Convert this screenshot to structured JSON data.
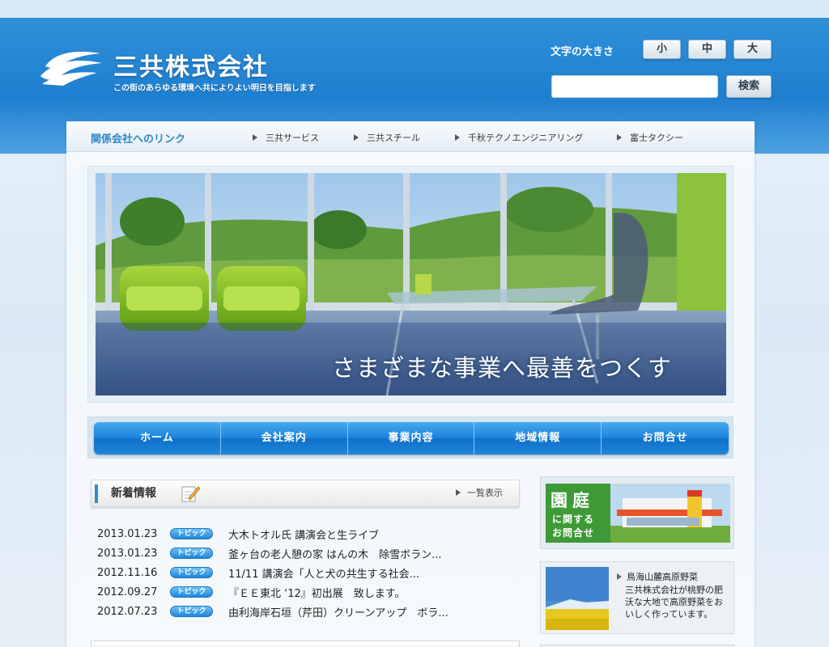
{
  "header": {
    "company_name": "三共株式会社",
    "tagline": "この街のあらゆる環境へ共によりよい明日を目指します",
    "font_size_label": "文字の大きさ",
    "font_sizes": [
      "小",
      "中",
      "大"
    ],
    "search_placeholder": "",
    "search_button": "検索"
  },
  "related_links": {
    "title": "関係会社へのリンク",
    "items": [
      "三共サービス",
      "三共スチール",
      "千秋テクノエンジニアリング",
      "富士タクシー"
    ]
  },
  "hero": {
    "caption": "さまざまな事業へ最善をつくす"
  },
  "nav": {
    "items": [
      "ホーム",
      "会社案内",
      "事業内容",
      "地域情報",
      "お問合せ"
    ]
  },
  "news": {
    "title": "新着情報",
    "more_label": "一覧表示",
    "items": [
      {
        "date": "2013.01.23",
        "tag": "トピック",
        "text": "大木トオル氏 講演会と生ライブ"
      },
      {
        "date": "2013.01.23",
        "tag": "トピック",
        "text": "釜ヶ台の老人憩の家 はんの木　除雪ボラン..."
      },
      {
        "date": "2012.11.16",
        "tag": "トピック",
        "text": "11/11 講演会「人と犬の共生する社会..."
      },
      {
        "date": "2012.09.27",
        "tag": "トピック",
        "text": "『ＥＥ東北 ‘12』初出展　致します。"
      },
      {
        "date": "2012.07.23",
        "tag": "トピック",
        "text": "由利海岸石垣（芹田）クリーンアップ　ボラ..."
      }
    ]
  },
  "sidebar": {
    "garden": {
      "big": "園庭",
      "line1": "に関する",
      "line2": "お問合せ"
    },
    "vegetables": {
      "title": "鳥海山麓高原野菜",
      "body": "三共株式会社が桃野の肥沃な大地で高原野菜をおいしく作っています。"
    }
  },
  "colors": {
    "brand_blue": "#1e7fd0",
    "accent_green": "#3d9a36"
  }
}
